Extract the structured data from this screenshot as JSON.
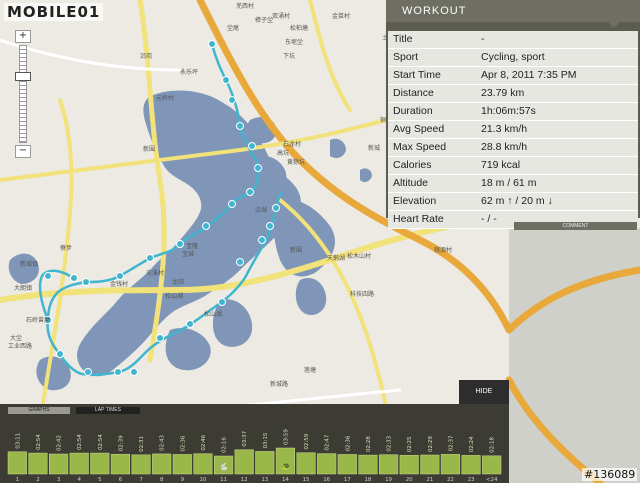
{
  "logo": {
    "text": "MOBILE01"
  },
  "zoom": {
    "plus": "+",
    "minus": "−",
    "level": 0.3
  },
  "map": {
    "labels": [
      "羌西村",
      "樟子坣",
      "坣尾",
      "双涌村",
      "松柏塘",
      "金苗村",
      "东坭坣",
      "下坑",
      "沿岗",
      "元岭村",
      "新围",
      "永乐坪",
      "石龙村",
      "高坑",
      "黄猄坑",
      "新城",
      "土岗",
      "宝隆",
      "宝城",
      "新围",
      "桃源村",
      "石岭",
      "龙岗",
      "屯溪村",
      "铜冈",
      "松山湖",
      "松木山村",
      "松山湖",
      "沿湖",
      "天鹅湖",
      "科技四路",
      "工业西路",
      "新城路",
      "金瑞村",
      "莲塘",
      "金钱村",
      "寮步",
      "大朗镇",
      "曾屋",
      "大坣",
      "新城镇"
    ]
  },
  "workout": {
    "header": "WORKOUT",
    "rows": [
      {
        "key": "Title",
        "value": "-"
      },
      {
        "key": "Sport",
        "value": "Cycling, sport"
      },
      {
        "key": "Start Time",
        "value": "Apr 8, 2011 7:35 PM"
      },
      {
        "key": "Distance",
        "value": "23.79 km"
      },
      {
        "key": "Duration",
        "value": "1h:06m:57s"
      },
      {
        "key": "Avg Speed",
        "value": "21.3 km/h"
      },
      {
        "key": "Max Speed",
        "value": "28.8 km/h"
      },
      {
        "key": "Calories",
        "value": "719 kcal"
      },
      {
        "key": "Altitude",
        "value": "18 m / 61 m"
      },
      {
        "key": "Elevation",
        "value": "62 m ↑ / 20 m ↓"
      },
      {
        "key": "Heart Rate",
        "value": "- / -"
      }
    ]
  },
  "comment_label": "COMMENT",
  "hide_label": "HIDE",
  "tabs": {
    "graphs": "GRAPHS",
    "laps": "LAP TIMES"
  },
  "laps": [
    {
      "n": "1",
      "time": "03:11"
    },
    {
      "n": "2",
      "time": "02:54"
    },
    {
      "n": "3",
      "time": "02:42"
    },
    {
      "n": "4",
      "time": "02:54"
    },
    {
      "n": "5",
      "time": "02:54"
    },
    {
      "n": "6",
      "time": "02:39"
    },
    {
      "n": "7",
      "time": "02:31"
    },
    {
      "n": "8",
      "time": "02:43"
    },
    {
      "n": "9",
      "time": "02:36"
    },
    {
      "n": "10",
      "time": "02:46"
    },
    {
      "n": "11",
      "time": "02:16"
    },
    {
      "n": "12",
      "time": "03:37"
    },
    {
      "n": "13",
      "time": "03:15"
    },
    {
      "n": "14",
      "time": "03:59"
    },
    {
      "n": "15",
      "time": "02:59"
    },
    {
      "n": "16",
      "time": "02:47"
    },
    {
      "n": "17",
      "time": "02:36"
    },
    {
      "n": "18",
      "time": "02:28"
    },
    {
      "n": "19",
      "time": "02:33"
    },
    {
      "n": "20",
      "time": "02:25"
    },
    {
      "n": "21",
      "time": "02:29"
    },
    {
      "n": "22",
      "time": "02:37"
    },
    {
      "n": "23",
      "time": "02:24"
    },
    {
      "n": "<24",
      "time": "02:18"
    }
  ],
  "markers": {
    "fastest_lap": "11",
    "slowest_lap": "14"
  },
  "watermark": "#136089",
  "colors": {
    "water": "#7f96b8",
    "route": "#3fb6ce",
    "road_yellow": "#f2e27a",
    "road_orange": "#e9a83a",
    "lap_bar": "#9ab84a"
  }
}
